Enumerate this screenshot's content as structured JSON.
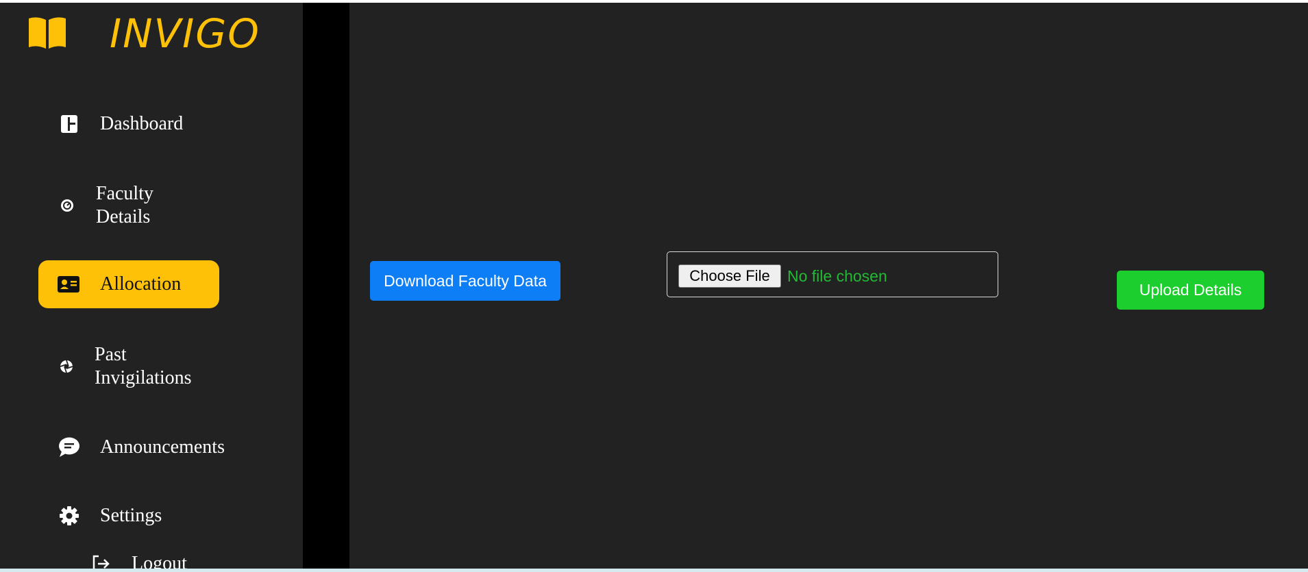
{
  "brand": {
    "name": "INVIGO",
    "icon": "open-book-icon",
    "color": "#ffc107"
  },
  "sidebar": {
    "items": [
      {
        "label": "Dashboard",
        "icon": "dashboard-icon"
      },
      {
        "label": "Faculty\nDetails",
        "icon": "gauge-icon"
      },
      {
        "label": "Allocation",
        "icon": "id-card-icon",
        "active": true
      },
      {
        "label": "Past\nInvigilations",
        "icon": "aperture-icon"
      },
      {
        "label": "Announcements",
        "icon": "chat-bubble-icon"
      },
      {
        "label": "Settings",
        "icon": "gear-icon"
      },
      {
        "label": "Logout",
        "icon": "logout-icon"
      }
    ]
  },
  "main": {
    "download_label": "Download Faculty Data",
    "file_input": {
      "button_label": "Choose File",
      "status": "No file chosen"
    },
    "upload_label": "Upload Details"
  },
  "colors": {
    "active_nav": "#ffc107",
    "download_button": "#0d7ef5",
    "upload_button": "#1dcf2e",
    "file_status": "#22bb33",
    "background": "#222222"
  }
}
